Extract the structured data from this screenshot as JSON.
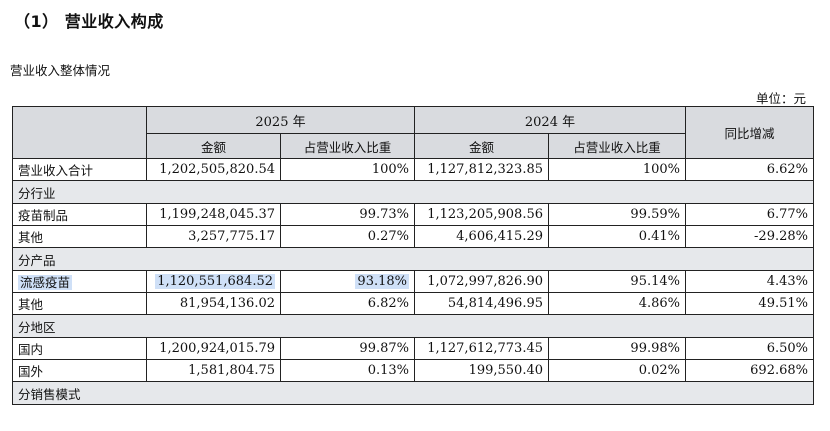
{
  "heading": "（1） 营业收入构成",
  "subheading": "营业收入整体情况",
  "unit_label": "单位：元",
  "header": {
    "year_2025": "2025 年",
    "year_2024": "2024 年",
    "yoy": "同比增减",
    "amount": "金额",
    "share": "占营业收入比重"
  },
  "rows": {
    "total": {
      "label": "营业收入合计",
      "amt_2025": "1,202,505,820.54",
      "share_2025": "100%",
      "amt_2024": "1,127,812,323.85",
      "share_2024": "100%",
      "yoy": "6.62%"
    },
    "section_industry": "分行业",
    "vaccine_products": {
      "label": "疫苗制品",
      "amt_2025": "1,199,248,045.37",
      "share_2025": "99.73%",
      "amt_2024": "1,123,205,908.56",
      "share_2024": "99.59%",
      "yoy": "6.77%"
    },
    "industry_other": {
      "label": "其他",
      "amt_2025": "3,257,775.17",
      "share_2025": "0.27%",
      "amt_2024": "4,606,415.29",
      "share_2024": "0.41%",
      "yoy": "-29.28%"
    },
    "section_product": "分产品",
    "flu_vaccine": {
      "label": "流感疫苗",
      "amt_2025": "1,120,551,684.52",
      "share_2025": "93.18%",
      "amt_2024": "1,072,997,826.90",
      "share_2024": "95.14%",
      "yoy": "4.43%"
    },
    "product_other": {
      "label": "其他",
      "amt_2025": "81,954,136.02",
      "share_2025": "6.82%",
      "amt_2024": "54,814,496.95",
      "share_2024": "4.86%",
      "yoy": "49.51%"
    },
    "section_region": "分地区",
    "domestic": {
      "label": "国内",
      "amt_2025": "1,200,924,015.79",
      "share_2025": "99.87%",
      "amt_2024": "1,127,612,773.45",
      "share_2024": "99.98%",
      "yoy": "6.50%"
    },
    "overseas": {
      "label": "国外",
      "amt_2025": "1,581,804.75",
      "share_2025": "0.13%",
      "amt_2024": "199,550.40",
      "share_2024": "0.02%",
      "yoy": "692.68%"
    },
    "section_sales": "分销售模式"
  },
  "colors": {
    "header_bg": "#d9dbdf",
    "section_bg": "#e6e8eb",
    "highlight": "#cfe0f7"
  }
}
